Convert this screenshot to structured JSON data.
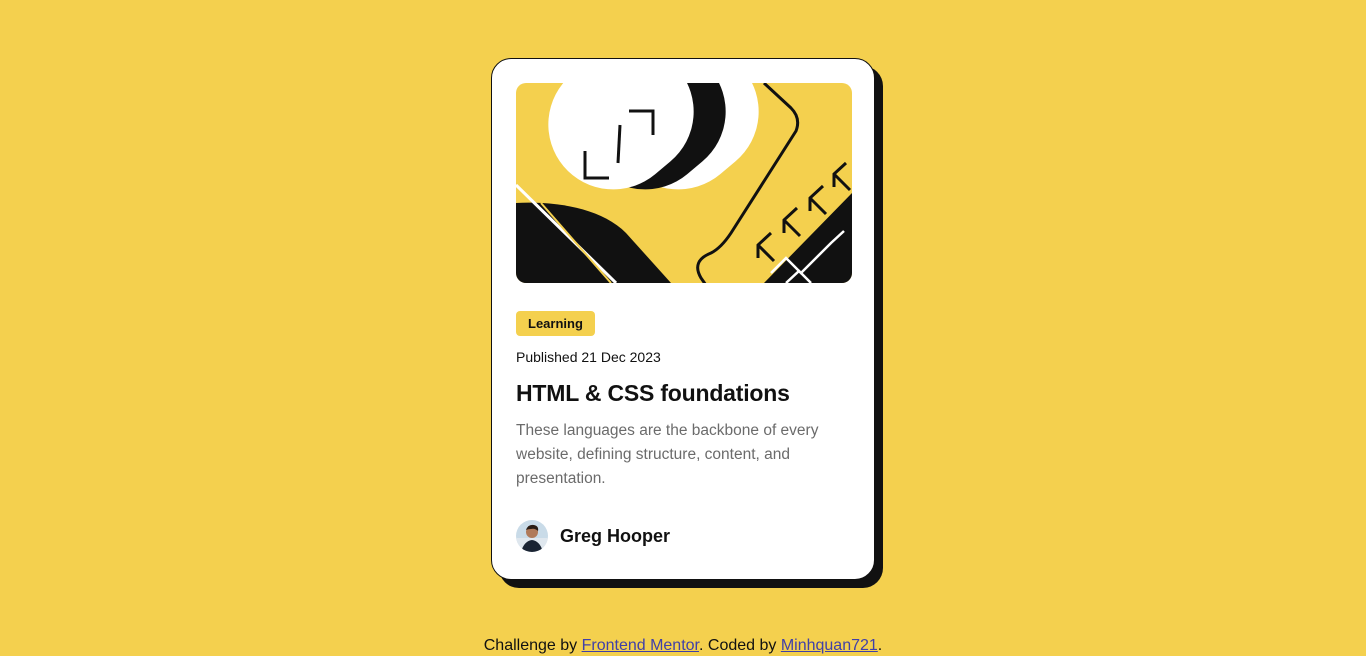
{
  "card": {
    "tag": "Learning",
    "published": "Published 21 Dec 2023",
    "title": "HTML & CSS foundations",
    "description": "These languages are the backbone of every website, defining structure, content, and presentation.",
    "author_name": "Greg Hooper"
  },
  "footer": {
    "prefix": "Challenge by ",
    "link1": "Frontend Mentor",
    "middle": ". Coded by ",
    "link2": "Minhquan721",
    "suffix": "."
  },
  "colors": {
    "background": "#f4d04e",
    "card": "#ffffff",
    "ink": "#111111",
    "muted_text": "#6b6b6b",
    "link": "#4040a8"
  },
  "icons": {
    "hero": "abstract-illustration",
    "avatar": "user-avatar"
  }
}
